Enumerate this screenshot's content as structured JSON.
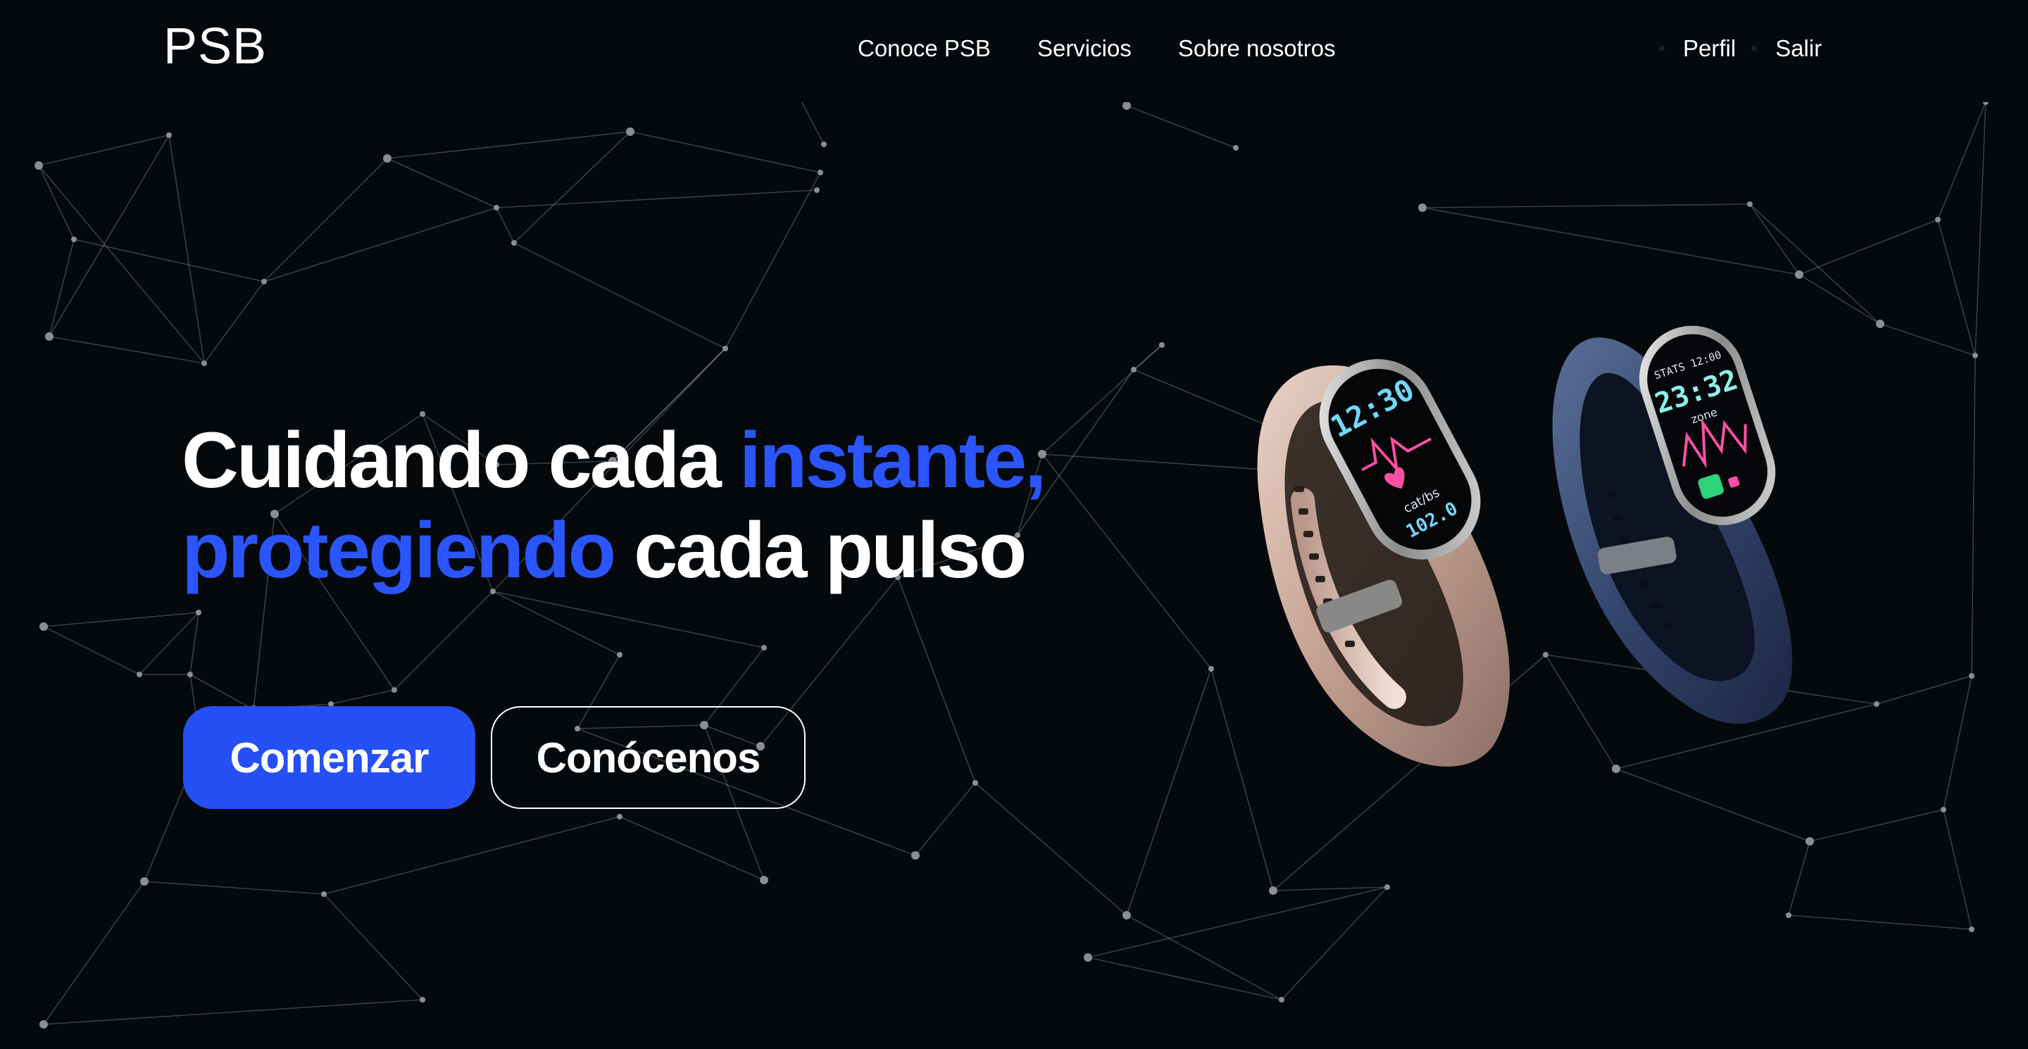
{
  "header": {
    "logo": "PSB",
    "nav": [
      "Conoce PSB",
      "Servicios",
      "Sobre nosotros"
    ],
    "user_nav": [
      "Perfil",
      "Salir"
    ]
  },
  "hero": {
    "title_part1": "Cuidando cada ",
    "title_accent1": "instante,",
    "title_accent2": "protegiendo",
    "title_part2": " cada pulso",
    "primary_button": "Comenzar",
    "secondary_button": "Conócenos"
  },
  "product_image": {
    "left_band": {
      "screen_time": "12:30",
      "screen_label": "cat/bs",
      "screen_value": "102.0"
    },
    "right_band": {
      "screen_header": "STATS 12:00",
      "screen_time": "23:32",
      "screen_label": "zone"
    }
  },
  "colors": {
    "background": "#05090c",
    "accent": "#2b55ff",
    "primary_button": "#2550f5",
    "text": "#ffffff"
  },
  "icons": [
    "network-background",
    "fitness-band-image"
  ]
}
